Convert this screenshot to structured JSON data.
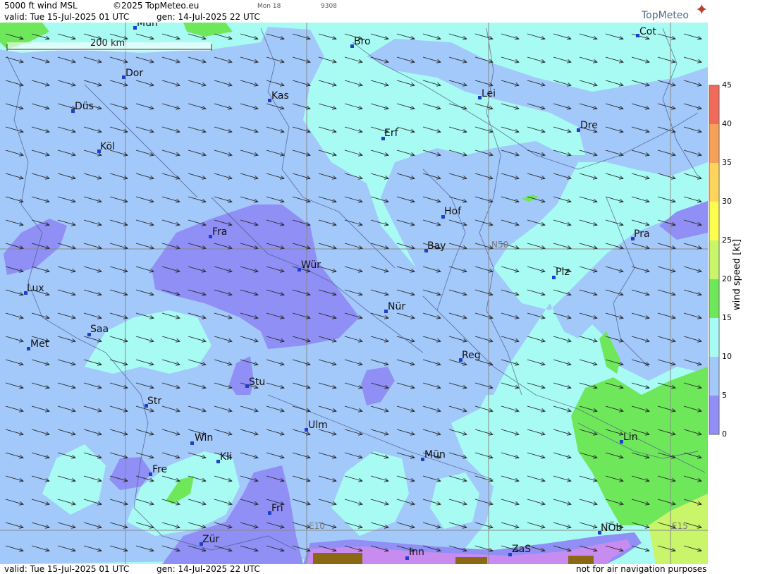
{
  "header": {
    "title": "5000 ft wind MSL",
    "copyright": "©2025 TopMeteo.eu",
    "day": "Mon 18",
    "code": "9308",
    "valid": "valid:  Tue  15-Jul-2025  01 UTC",
    "gen": "gen: 14-Jul-2025 22 UTC",
    "logo": "TopMeteo"
  },
  "footer": {
    "valid": "valid:  Tue  15-Jul-2025  01 UTC",
    "gen": "gen: 14-Jul-2025 22 UTC",
    "disclaimer": "not for air navigation purposes"
  },
  "scale": {
    "label": "200 km"
  },
  "grid_labels": {
    "n50": "N50",
    "e10": "E10",
    "e15": "E15"
  },
  "cities": [
    {
      "name": "Mün"
    },
    {
      "name": "Bro"
    },
    {
      "name": "Cot"
    },
    {
      "name": "Dor"
    },
    {
      "name": "Kas"
    },
    {
      "name": "Lei"
    },
    {
      "name": "Düs"
    },
    {
      "name": "Dre"
    },
    {
      "name": "Erf"
    },
    {
      "name": "Köl"
    },
    {
      "name": "Hof"
    },
    {
      "name": "Fra"
    },
    {
      "name": "Pra"
    },
    {
      "name": "Bay"
    },
    {
      "name": "Wür"
    },
    {
      "name": "Plz"
    },
    {
      "name": "Lux"
    },
    {
      "name": "Nür"
    },
    {
      "name": "Saa"
    },
    {
      "name": "Met"
    },
    {
      "name": "Reg"
    },
    {
      "name": "Stu"
    },
    {
      "name": "Str"
    },
    {
      "name": "Ulm"
    },
    {
      "name": "Win"
    },
    {
      "name": "Lin"
    },
    {
      "name": "Kli"
    },
    {
      "name": "Mün"
    },
    {
      "name": "Fre"
    },
    {
      "name": "Fri"
    },
    {
      "name": "NÖb"
    },
    {
      "name": "Zür"
    },
    {
      "name": "Inn"
    },
    {
      "name": "ZaS"
    }
  ],
  "legend": {
    "title": "wind speed [kt]",
    "ticks": [
      "45",
      "40",
      "35",
      "30",
      "25",
      "20",
      "15",
      "10",
      "5",
      "0"
    ],
    "colors": [
      "#f06a5a",
      "#f7a05a",
      "#fdd55a",
      "#fdfd50",
      "#c8f56a",
      "#6ee85a",
      "#a8fbf3",
      "#a3c8fa",
      "#8f8ff5",
      "#c88cf0"
    ]
  },
  "wind": {
    "direction": "west-to-east, slight southerly component"
  },
  "colors": {
    "calm": "#a8fbf3",
    "light": "#a3c8fa",
    "moderate": "#8f8ff5",
    "strong": "#6ee85a",
    "very_light": "#c88cf0",
    "terrain": "#8b6914"
  }
}
